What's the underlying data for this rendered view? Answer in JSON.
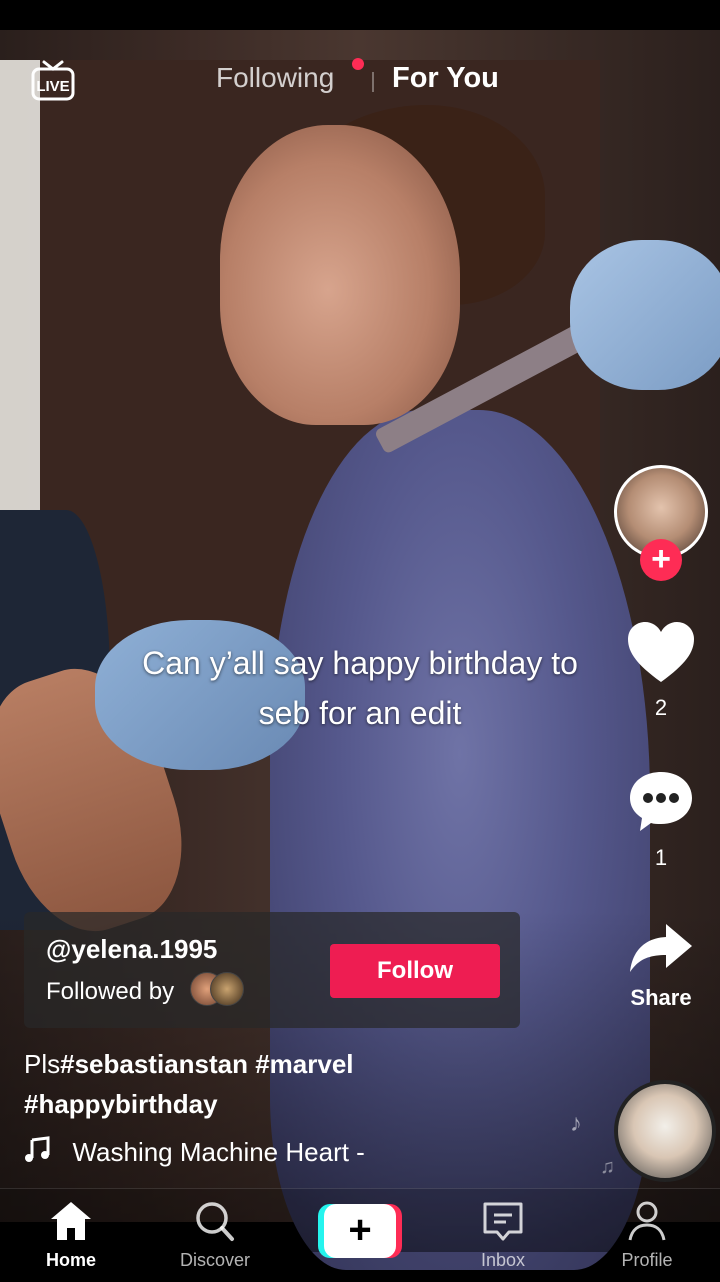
{
  "top_bar": {
    "tabs": [
      "Following",
      "For You"
    ],
    "active_tab": "For You"
  },
  "video": {
    "overlay_text": "Can y’all say happy birthday to seb for an edit"
  },
  "right_rail": {
    "likes": "2",
    "comments": "1",
    "share_label": "Share"
  },
  "author": {
    "username": "@yelena.1995",
    "followed_by_label": "Followed by",
    "follow_label": "Follow"
  },
  "description": {
    "prefix": "Pls",
    "hashtags": "#sebastianstan #marvel #happybirthday"
  },
  "music": {
    "title": "Washing Machine Heart - "
  },
  "bottom_nav": {
    "home": "Home",
    "discover": "Discover",
    "inbox": "Inbox",
    "profile": "Profile"
  },
  "colors": {
    "accent": "#fe2c55",
    "follow_button": "#ee1d52",
    "create_cyan": "#25f4ee"
  },
  "icons": [
    "live-icon",
    "heart-icon",
    "comment-icon",
    "share-icon",
    "music-note-icon",
    "home-icon",
    "search-icon",
    "plus-icon",
    "inbox-icon",
    "profile-icon"
  ]
}
